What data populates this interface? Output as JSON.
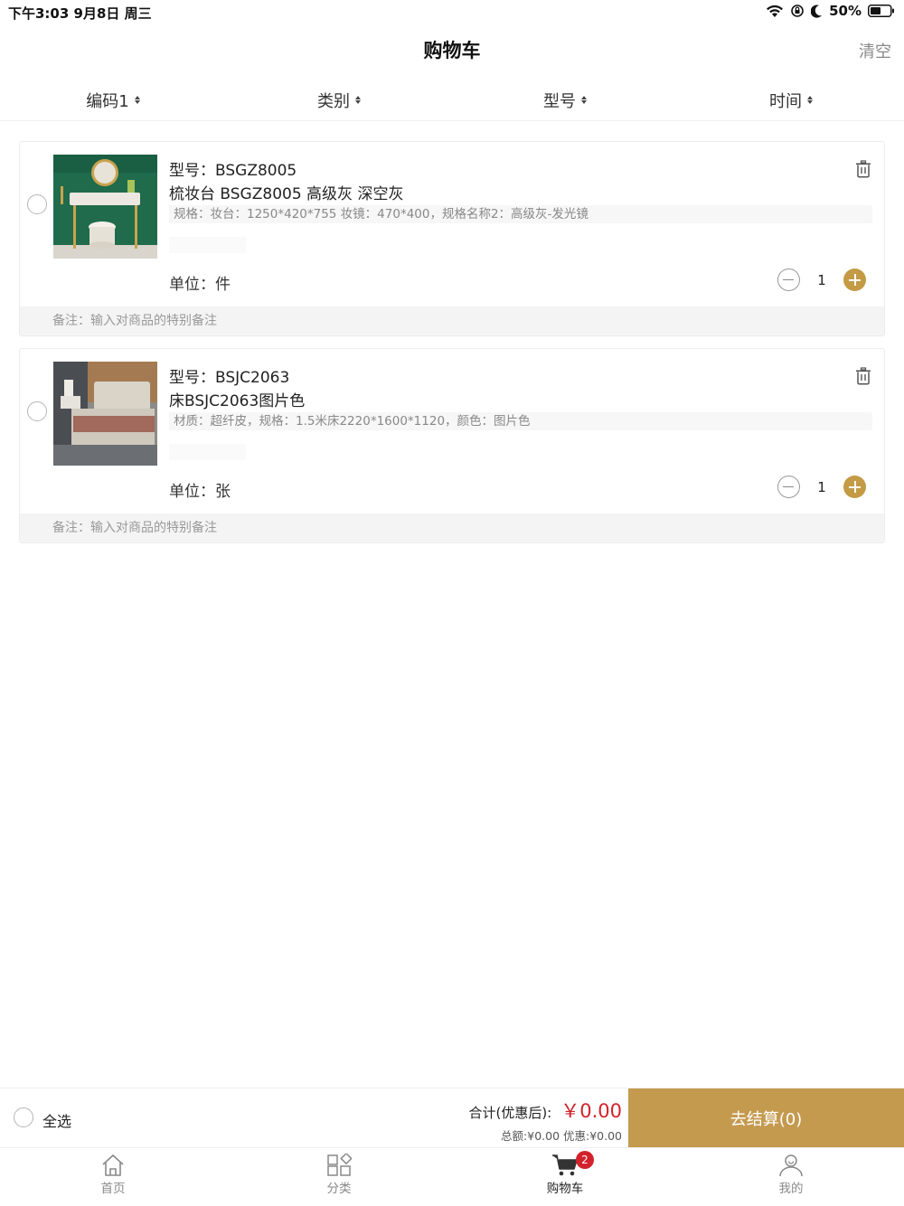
{
  "status_bar": {
    "time": "下午3:03   9月8日 周三",
    "battery": "50%"
  },
  "header": {
    "title": "购物车",
    "clear_label": "清空"
  },
  "sort_options": [
    {
      "label": "编码1"
    },
    {
      "label": "类别"
    },
    {
      "label": "型号"
    },
    {
      "label": "时间"
    }
  ],
  "cart_items": [
    {
      "model": "型号：BSGZ8005",
      "name": "梳妆台 BSGZ8005 高级灰 深空灰",
      "spec": "规格：妆台：1250*420*755 妆镜：470*400，规格名称2：高级灰-发光镜",
      "unit": "单位：件",
      "quantity": "1",
      "remark_placeholder": "备注：输入对商品的特别备注",
      "image": "dressing-table-photo"
    },
    {
      "model": "型号：BSJC2063",
      "name": "床BSJC2063图片色",
      "spec": "材质：超纤皮，规格：1.5米床2220*1600*1120，颜色：图片色",
      "unit": "单位：张",
      "quantity": "1",
      "remark_placeholder": "备注：输入对商品的特别备注",
      "image": "bed-photo"
    }
  ],
  "checkout": {
    "select_all_label": "全选",
    "total_label": "合计(优惠后):",
    "total_amount": "￥0.00",
    "sub_totals": "总额:¥0.00 优惠:¥0.00",
    "checkout_button": "去结算(0)"
  },
  "tab_bar": {
    "tabs": [
      {
        "label": "首页",
        "icon": "home-icon",
        "active": false
      },
      {
        "label": "分类",
        "icon": "category-icon",
        "active": false
      },
      {
        "label": "购物车",
        "icon": "cart-icon",
        "active": true,
        "badge": "2"
      },
      {
        "label": "我的",
        "icon": "user-icon",
        "active": false
      }
    ]
  },
  "colors": {
    "accent": "#c49a45",
    "price": "#d2222b",
    "checkout_button": "#c49a4f"
  }
}
